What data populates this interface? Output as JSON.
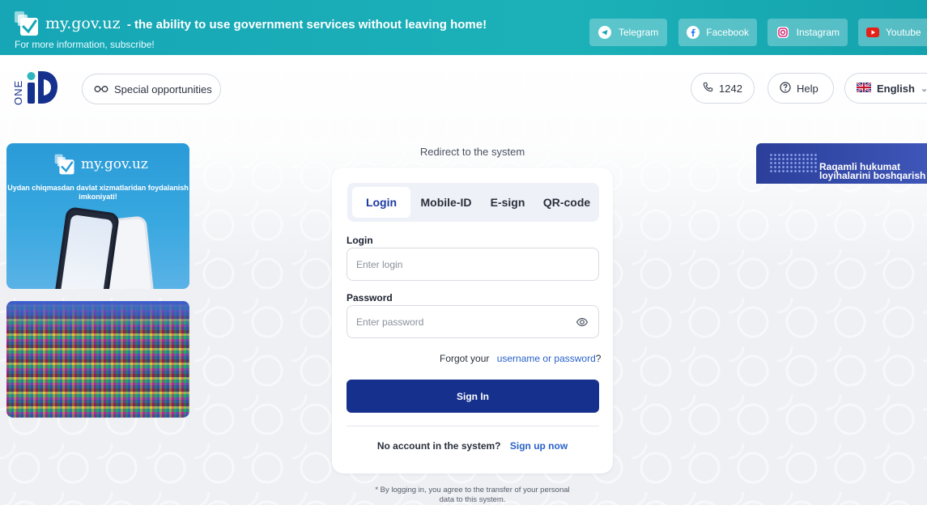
{
  "banner": {
    "brand": "my.gov.uz",
    "tagline": "- the ability to use government services without leaving home!",
    "subtitle": "For more information, subscribe!",
    "social": [
      {
        "label": "Telegram",
        "icon": "telegram-icon"
      },
      {
        "label": "Facebook",
        "icon": "facebook-icon"
      },
      {
        "label": "Instagram",
        "icon": "instagram-icon"
      },
      {
        "label": "Youtube",
        "icon": "youtube-icon"
      }
    ]
  },
  "header": {
    "logo_text": "ONE",
    "special_opportunities": "Special opportunities",
    "phone": "1242",
    "help": "Help",
    "language": "English"
  },
  "ads": {
    "left_top_brand": "my.gov.uz",
    "left_top_text": "Uydan chiqmasdan davlat xizmatlaridan foydalanish imkoniyati!",
    "right_text_line1": "Raqamli hukumat",
    "right_text_line2": "loyihalarini boshqarish"
  },
  "login": {
    "redirect_title": "Redirect to the system",
    "tabs": [
      "Login",
      "Mobile-ID",
      "E-sign",
      "QR-code"
    ],
    "active_tab": "Login",
    "login_label": "Login",
    "login_placeholder": "Enter login",
    "password_label": "Password",
    "password_placeholder": "Enter password",
    "forgot_prefix": "Forgot your",
    "forgot_link": "username or password",
    "forgot_suffix": "?",
    "sign_in": "Sign In",
    "no_account": "No account in the system?",
    "sign_up": "Sign up now",
    "consent_line1": "* By logging in, you agree to the transfer of your personal",
    "consent_line2": "data to this system."
  },
  "colors": {
    "banner": "#16a6b6",
    "primary_button": "#16308d",
    "link": "#2a62c9",
    "active_tab_text": "#1d3aa0"
  }
}
